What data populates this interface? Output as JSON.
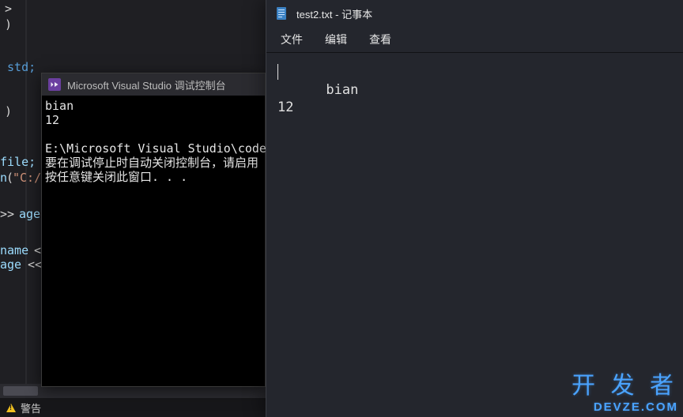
{
  "editor": {
    "fragments": {
      "angleClose1": ">",
      "closeParen1": ")",
      "std": " std;",
      "closeParen2": ")",
      "fileSemi": "file;",
      "openCall": "(",
      "openStr": "\"C:/",
      "shiftOp": ">> ",
      "ageId": "age",
      "nameId": "name",
      "ageId2": "age",
      "ins1": " <<",
      "ins2": " <<"
    },
    "scrollbar": {
      "visible": true
    }
  },
  "console": {
    "title": "Microsoft Visual Studio 调试控制台",
    "lines": [
      "bian",
      "12",
      "",
      "E:\\Microsoft Visual Studio\\code\\Pro",
      "要在调试停止时自动关闭控制台，请启用",
      "按任意键关闭此窗口. . ."
    ]
  },
  "notepad": {
    "title": "test2.txt - 记事本",
    "menu": {
      "file": "文件",
      "edit": "编辑",
      "view": "查看"
    },
    "content": "bian\n12"
  },
  "status": {
    "warning_label": "警告"
  },
  "watermark": {
    "cn": "开 发 者",
    "en": "DEVZE.COM"
  }
}
